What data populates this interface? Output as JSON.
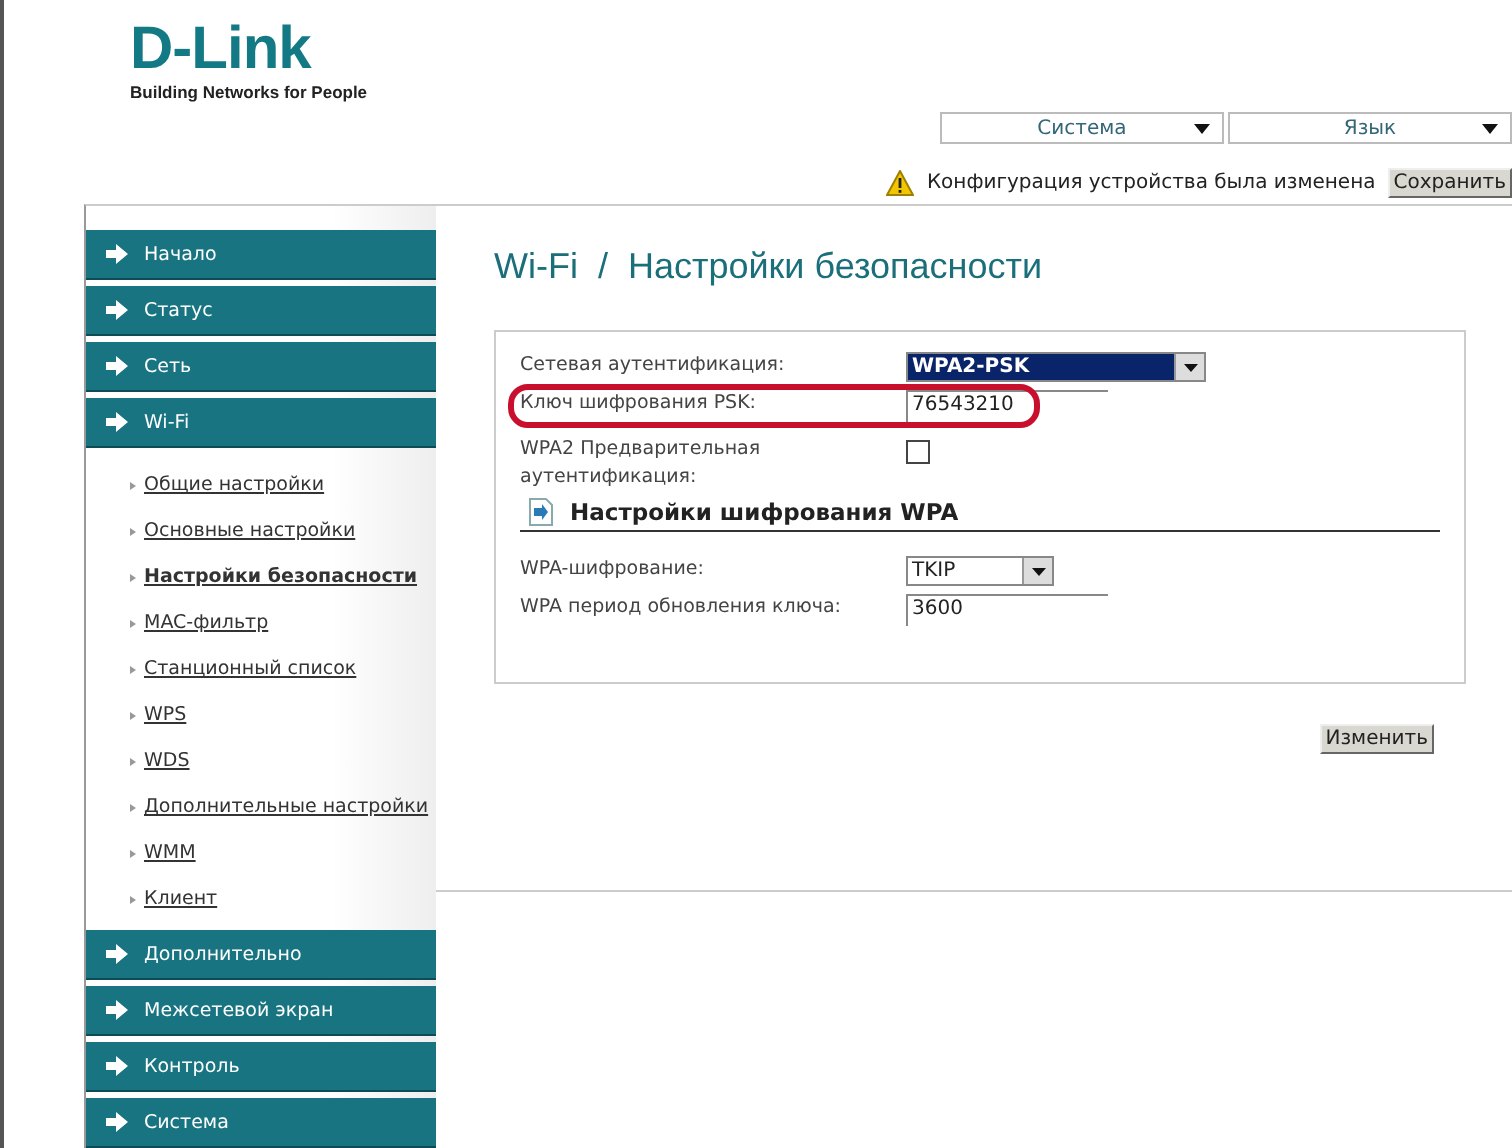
{
  "logo": {
    "name": "D-Link",
    "tagline": "Building Networks for People"
  },
  "top_menus": [
    {
      "label": "Система"
    },
    {
      "label": "Язык"
    }
  ],
  "notice": {
    "text": "Конфигурация устройства была изменена",
    "button": "Сохранить"
  },
  "sidebar": {
    "items": [
      {
        "label": "Начало"
      },
      {
        "label": "Статус"
      },
      {
        "label": "Сеть"
      },
      {
        "label": "Wi-Fi",
        "children": [
          {
            "label": "Общие настройки",
            "selected": false
          },
          {
            "label": "Основные настройки",
            "selected": false
          },
          {
            "label": "Настройки безопасности",
            "selected": true
          },
          {
            "label": "MAC-фильтр",
            "selected": false
          },
          {
            "label": "Станционный список",
            "selected": false
          },
          {
            "label": "WPS",
            "selected": false
          },
          {
            "label": "WDS",
            "selected": false
          },
          {
            "label": "Дополнительные настройки",
            "selected": false
          },
          {
            "label": "WMM",
            "selected": false
          },
          {
            "label": "Клиент",
            "selected": false
          }
        ]
      },
      {
        "label": "Дополнительно"
      },
      {
        "label": "Межсетевой экран"
      },
      {
        "label": "Контроль"
      },
      {
        "label": "Система"
      }
    ]
  },
  "page": {
    "title": "Wi-Fi  /  Настройки безопасности",
    "rows": [
      {
        "kind": "select",
        "label": "Сетевая аутентификация:",
        "value": "WPA2-PSK",
        "focused": true
      },
      {
        "kind": "text",
        "label": "Ключ шифрования PSK:",
        "value": "76543210",
        "highlighted": true
      },
      {
        "kind": "checkbox",
        "label": "WPA2 Предварительная аутентификация:",
        "checked": false
      },
      {
        "kind": "section",
        "label": "Настройки шифрования WPA"
      },
      {
        "kind": "select",
        "label": "WPA-шифрование:",
        "value": "TKIP",
        "focused": false
      },
      {
        "kind": "text",
        "label": "WPA период обновления ключа:",
        "value": "3600"
      }
    ],
    "button": "Изменить"
  }
}
